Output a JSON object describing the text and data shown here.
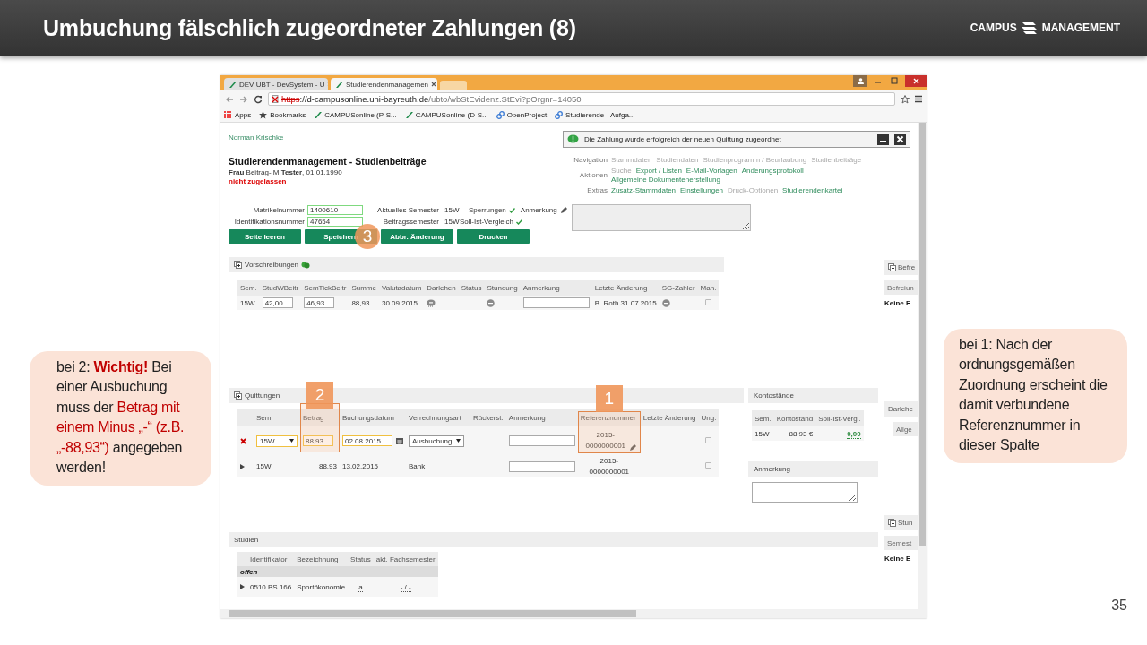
{
  "slide": {
    "title": "Umbuchung fälschlich zugeordneter Zahlungen (8)",
    "logo": {
      "left": "CAMPUS",
      "right": "MANAGEMENT"
    },
    "page_number": "35"
  },
  "callouts": [
    {
      "text": "bei 2: **Wichtig!** Bei einer Ausbuchung muss der *Betrag mit einem Minus „-“ (z.B. „-88,93“)* angegeben werden!"
    },
    {
      "text": "bei 1: Nach der ordnungsgemäßen Zuordnung erscheint die damit verbundene Referenznummer in dieser Spalte"
    }
  ],
  "browser": {
    "tabs": [
      {
        "title": "DEV UBT - DevSystem - U",
        "selected": false
      },
      {
        "title": "Studierendenmanagemen",
        "selected": true
      }
    ],
    "url": {
      "scheme": "https",
      "host": "://d-campusonline.uni-bayreuth.de",
      "path": "/ubto/wbStEvidenz.StEvi?pOrgnr=14050"
    },
    "bookmarks": [
      {
        "kind": "apps",
        "label": "Apps"
      },
      {
        "kind": "star",
        "label": "Bookmarks"
      },
      {
        "kind": "site",
        "label": "CAMPUSonline (P-S..."
      },
      {
        "kind": "site",
        "label": "CAMPUSonline (D-S..."
      },
      {
        "kind": "link",
        "label": "OpenProject"
      },
      {
        "kind": "link",
        "label": "Studierende - Aufga..."
      }
    ]
  },
  "page": {
    "user": "Norman Krischke",
    "heading": "Studierendenmanagement - Studienbeiträge",
    "person": "**Frau** Beitrag-IM **Tester**, 01.01.1990",
    "status": "nicht zugelassen",
    "notification": "Die Zahlung wurde erfolgreich der neuen Quittung zugeordnet",
    "nav": [
      {
        "label": "Navigation",
        "lines": [
          [
            {
              "text": "Stammdaten",
              "enabled": false
            },
            {
              "text": "Studiendaten",
              "enabled": false
            },
            {
              "text": "Studienprogramm / Beurlaubung",
              "enabled": false
            },
            {
              "text": "Studienbeiträge",
              "enabled": false
            }
          ]
        ]
      },
      {
        "label": "Aktionen",
        "lines": [
          [
            {
              "text": "Suche",
              "enabled": false
            },
            {
              "text": "Export / Listen",
              "enabled": true
            },
            {
              "text": "E-Mail-Vorlagen",
              "enabled": true
            },
            {
              "text": "Änderungsprotokoll",
              "enabled": true
            }
          ],
          [
            {
              "text": "Allgemeine Dokumentenerstellung",
              "enabled": true
            }
          ]
        ]
      },
      {
        "label": "Extras",
        "lines": [
          [
            {
              "text": "Zusatz-Stammdaten",
              "enabled": true
            },
            {
              "text": "Einstellungen",
              "enabled": true
            },
            {
              "text": "Druck-Optionen",
              "enabled": false
            },
            {
              "text": "Studierendenkartei",
              "enabled": true
            }
          ]
        ]
      }
    ],
    "fields": [
      {
        "label": "Matrikelnummer",
        "value": "1400610",
        "info_label": "Aktuelles Semester",
        "info_value": "15W"
      },
      {
        "label": "Identifikationsnummer",
        "value": "47654",
        "info_label": "Beitragssemester",
        "info_value": "15W"
      }
    ],
    "flags": [
      {
        "label": "Sperrungen",
        "checked": true
      },
      {
        "label": "Soll-Ist-Vergleich",
        "checked": true
      }
    ],
    "remark_label": "Anmerkung",
    "buttons": [
      {
        "label": "Seite leeren"
      },
      {
        "label": "Speichern",
        "marker": "3"
      },
      {
        "label": "Abbr. Änderung"
      },
      {
        "label": "Drucken"
      }
    ],
    "prescriptions": {
      "title": "Vorschreibungen",
      "expandable": true,
      "sync": true,
      "columns": [
        {
          "label": "Sem."
        },
        {
          "label": "StudWBeitr"
        },
        {
          "label": "SemTickBeitr"
        },
        {
          "label": "Summe"
        },
        {
          "label": "Valutadatum"
        },
        {
          "label": "Darlehen"
        },
        {
          "label": "Status"
        },
        {
          "label": "Stundung"
        },
        {
          "label": "Anmerkung"
        },
        {
          "label": "Letzte Änderung"
        },
        {
          "label": "SG-Zahler"
        },
        {
          "label": "Man."
        }
      ],
      "rows": [
        {
          "cells": [
            {
              "kind": "text",
              "text": "15W"
            },
            {
              "kind": "input",
              "value": "42,00",
              "modified": false
            },
            {
              "kind": "input",
              "value": "46,93",
              "modified": false
            },
            {
              "kind": "text",
              "text": "88,93"
            },
            {
              "kind": "text",
              "text": "30.09.2015"
            },
            {
              "kind": "stack"
            },
            {
              "kind": "empty"
            },
            {
              "kind": "dot"
            },
            {
              "kind": "note",
              "modified": false
            },
            {
              "kind": "text",
              "text": "B. Roth 31.07.2015"
            },
            {
              "kind": "dot"
            },
            {
              "kind": "checkbox",
              "checked": false
            }
          ]
        }
      ]
    },
    "receipts": {
      "title": "Quittungen",
      "expandable": true,
      "sync": false,
      "columns": [
        {},
        {
          "label": "Sem."
        },
        {
          "label": "Betrag",
          "marker": "2"
        },
        {
          "label": "Buchungsdatum"
        },
        {
          "label": "Verrechnungsart"
        },
        {
          "label": "Rückerst."
        },
        {
          "label": "Anmerkung"
        },
        {
          "label": "Referenznummer",
          "marker": "1"
        },
        {
          "label": "Letzte Änderung"
        },
        {
          "label": "Ung."
        }
      ],
      "rows": [
        {
          "cells": [
            {
              "kind": "delete"
            },
            {
              "kind": "select",
              "value": "15W",
              "modified": true
            },
            {
              "kind": "input",
              "value": "88,93",
              "modified": true
            },
            {
              "kind": "date",
              "value": "02.08.2015",
              "modified": true
            },
            {
              "kind": "select",
              "value": "Ausbuchung",
              "modified": false
            },
            {
              "kind": "empty"
            },
            {
              "kind": "note",
              "modified": false
            },
            {
              "kind": "ref",
              "text": "2015-0000000001",
              "edit": true
            },
            {
              "kind": "empty"
            },
            {
              "kind": "checkbox",
              "checked": false
            }
          ]
        },
        {
          "cells": [
            {
              "kind": "expand"
            },
            {
              "kind": "text",
              "text": "15W"
            },
            {
              "kind": "number",
              "text": "88,93"
            },
            {
              "kind": "text",
              "text": "13.02.2015"
            },
            {
              "kind": "text",
              "text": "Bank"
            },
            {
              "kind": "empty"
            },
            {
              "kind": "note",
              "modified": false
            },
            {
              "kind": "ref",
              "text": "2015-0000000001",
              "edit": false
            },
            {
              "kind": "empty"
            },
            {
              "kind": "checkbox",
              "checked": false
            }
          ]
        }
      ]
    },
    "balances": {
      "title": "Kontostände",
      "columns": [
        {
          "label": "Sem."
        },
        {
          "label": "Kontostand"
        },
        {
          "label": "Soll-Ist-Vergl."
        }
      ],
      "rows": [
        {
          "cells": [
            {
              "kind": "text",
              "text": "15W"
            },
            {
              "kind": "number",
              "text": "88,93 €"
            },
            {
              "kind": "balance",
              "text": "0,00"
            }
          ]
        }
      ]
    },
    "note_panel": {
      "title": "Anmerkung"
    },
    "studies": {
      "title": "Studien",
      "columns": [
        {},
        {
          "label": "Identifikator"
        },
        {
          "label": "Bezeichnung"
        },
        {
          "label": "Status"
        },
        {
          "label": "akt. Fachsemester"
        }
      ],
      "groups": [
        {
          "label": "offen",
          "rows": [
            {
              "cells": [
                {
                  "kind": "expand"
                },
                {
                  "kind": "text",
                  "text": "0510 BS 166"
                },
                {
                  "kind": "text",
                  "text": "Sportökonomie"
                },
                {
                  "kind": "abbr",
                  "text": "a"
                },
                {
                  "kind": "abbr",
                  "text": "- / -"
                }
              ]
            }
          ]
        }
      ]
    },
    "side_panels": [
      {
        "title": "Befre",
        "expandable": true,
        "header": "Befreiun",
        "value": "Keine E"
      },
      {
        "title": "Darlehe",
        "expandable": false,
        "header": "Allge"
      },
      {
        "title": "Stun",
        "expandable": true,
        "header": "Semest",
        "value": "Keine E"
      }
    ]
  }
}
